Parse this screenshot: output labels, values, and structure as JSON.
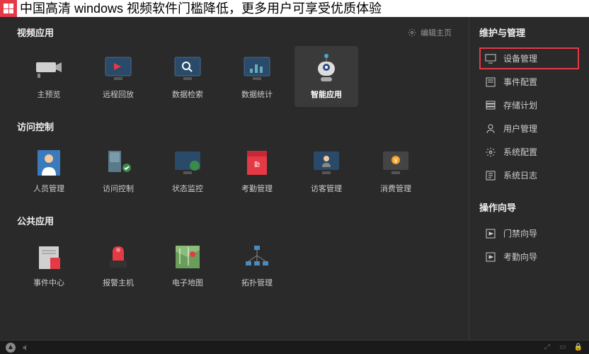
{
  "title": "中国高清 windows 视频软件门槛降低，更多用户可享受优质体验",
  "sections": {
    "video": {
      "title": "视频应用",
      "edit_label": "编辑主页",
      "items": [
        {
          "label": "主预览",
          "icon": "camera"
        },
        {
          "label": "远程回放",
          "icon": "playback"
        },
        {
          "label": "数据检索",
          "icon": "search-mon"
        },
        {
          "label": "数据统计",
          "icon": "stats"
        },
        {
          "label": "智能应用",
          "icon": "robot",
          "selected": true
        }
      ]
    },
    "access": {
      "title": "访问控制",
      "items": [
        {
          "label": "人员管理",
          "icon": "person"
        },
        {
          "label": "访问控制",
          "icon": "door"
        },
        {
          "label": "状态监控",
          "icon": "monitor"
        },
        {
          "label": "考勤管理",
          "icon": "attendance"
        },
        {
          "label": "访客管理",
          "icon": "visitor"
        },
        {
          "label": "消费管理",
          "icon": "consume"
        }
      ]
    },
    "public": {
      "title": "公共应用",
      "items": [
        {
          "label": "事件中心",
          "icon": "event"
        },
        {
          "label": "报警主机",
          "icon": "alarm"
        },
        {
          "label": "电子地图",
          "icon": "map"
        },
        {
          "label": "拓扑管理",
          "icon": "topo"
        }
      ]
    }
  },
  "sidebar": {
    "maintain": {
      "title": "维护与管理",
      "items": [
        {
          "label": "设备管理",
          "icon": "device",
          "highlighted": true
        },
        {
          "label": "事件配置",
          "icon": "event-cfg"
        },
        {
          "label": "存储计划",
          "icon": "storage"
        },
        {
          "label": "用户管理",
          "icon": "user"
        },
        {
          "label": "系统配置",
          "icon": "gear"
        },
        {
          "label": "系统日志",
          "icon": "log"
        }
      ]
    },
    "wizard": {
      "title": "操作向导",
      "items": [
        {
          "label": "门禁向导",
          "icon": "wizard"
        },
        {
          "label": "考勤向导",
          "icon": "wizard"
        }
      ]
    }
  }
}
